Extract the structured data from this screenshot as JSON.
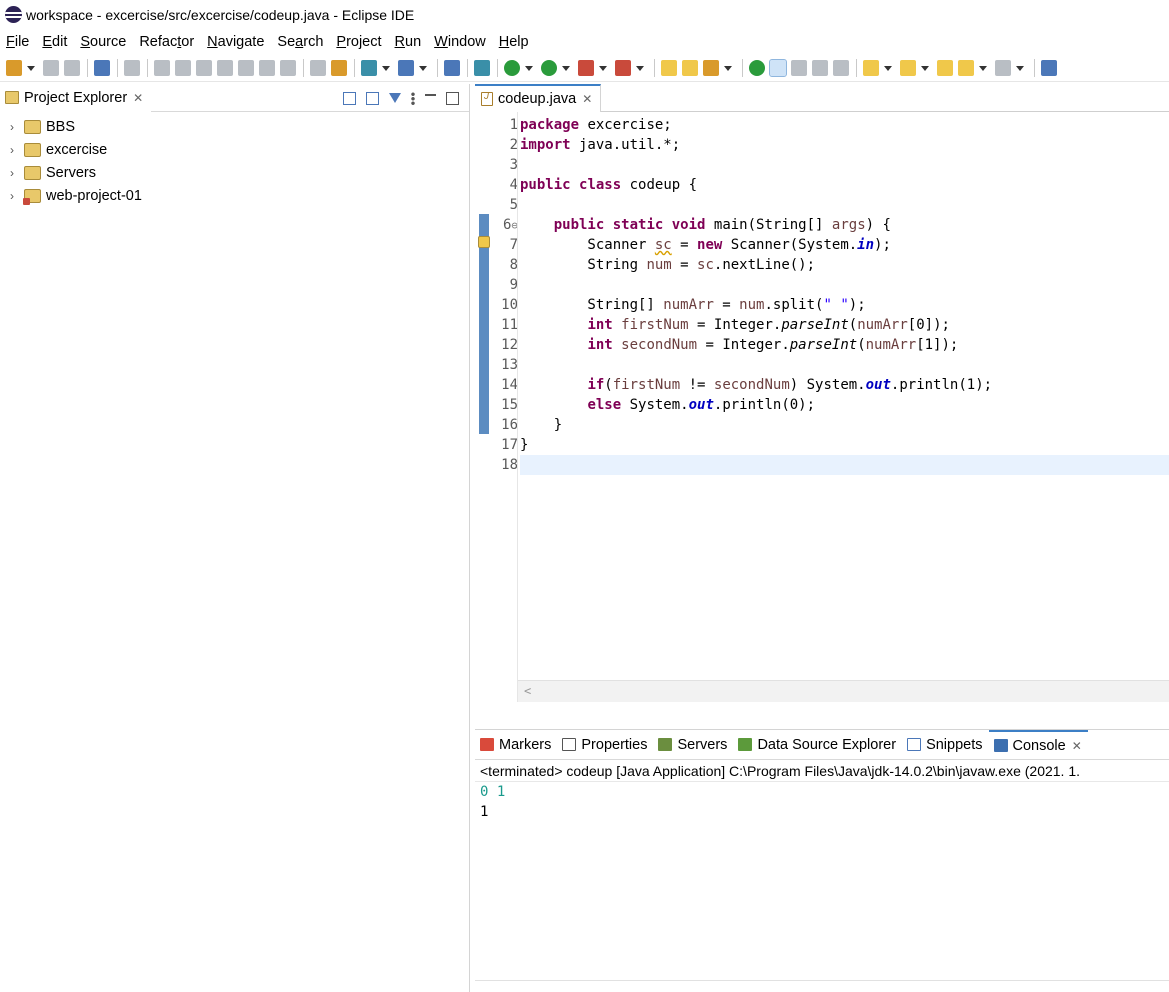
{
  "window": {
    "title": "workspace - excercise/src/excercise/codeup.java - Eclipse IDE"
  },
  "menu": [
    {
      "label": "File",
      "mnemonic_index": 0
    },
    {
      "label": "Edit",
      "mnemonic_index": 0
    },
    {
      "label": "Source",
      "mnemonic_index": 0
    },
    {
      "label": "Refactor",
      "mnemonic_index": 5
    },
    {
      "label": "Navigate",
      "mnemonic_index": 0
    },
    {
      "label": "Search",
      "mnemonic_index": 2
    },
    {
      "label": "Project",
      "mnemonic_index": 0
    },
    {
      "label": "Run",
      "mnemonic_index": 0
    },
    {
      "label": "Window",
      "mnemonic_index": 0
    },
    {
      "label": "Help",
      "mnemonic_index": 0
    }
  ],
  "project_explorer": {
    "tab_label": "Project Explorer",
    "items": [
      {
        "label": "BBS",
        "icon": "web-project-icon"
      },
      {
        "label": "excercise",
        "icon": "java-project-icon"
      },
      {
        "label": "Servers",
        "icon": "folder-icon"
      },
      {
        "label": "web-project-01",
        "icon": "web-project-error-icon"
      }
    ]
  },
  "editor": {
    "tab_label": "codeup.java",
    "line_numbers": [
      "1",
      "2",
      "3",
      "4",
      "5",
      "6",
      "7",
      "8",
      "9",
      "10",
      "11",
      "12",
      "13",
      "14",
      "15",
      "16",
      "17",
      "18"
    ],
    "current_line": 18
  },
  "bottom_panel": {
    "tabs": [
      {
        "label": "Markers",
        "icon": "markers-icon"
      },
      {
        "label": "Properties",
        "icon": "properties-icon"
      },
      {
        "label": "Servers",
        "icon": "servers-icon"
      },
      {
        "label": "Data Source Explorer",
        "icon": "data-source-icon"
      },
      {
        "label": "Snippets",
        "icon": "snippets-icon"
      },
      {
        "label": "Console",
        "icon": "console-icon",
        "active": true
      }
    ],
    "console_description": "<terminated> codeup [Java Application] C:\\Program Files\\Java\\jdk-14.0.2\\bin\\javaw.exe  (2021. 1.",
    "console_input": "0 1",
    "console_output": "1"
  },
  "colors": {
    "keyword": "#7f0055",
    "field": "#0000c0",
    "string": "#2a00ff",
    "local_var": "#6a3e3e",
    "console_input": "#1a9a8c",
    "active_tab_accent": "#3c7fc6"
  }
}
